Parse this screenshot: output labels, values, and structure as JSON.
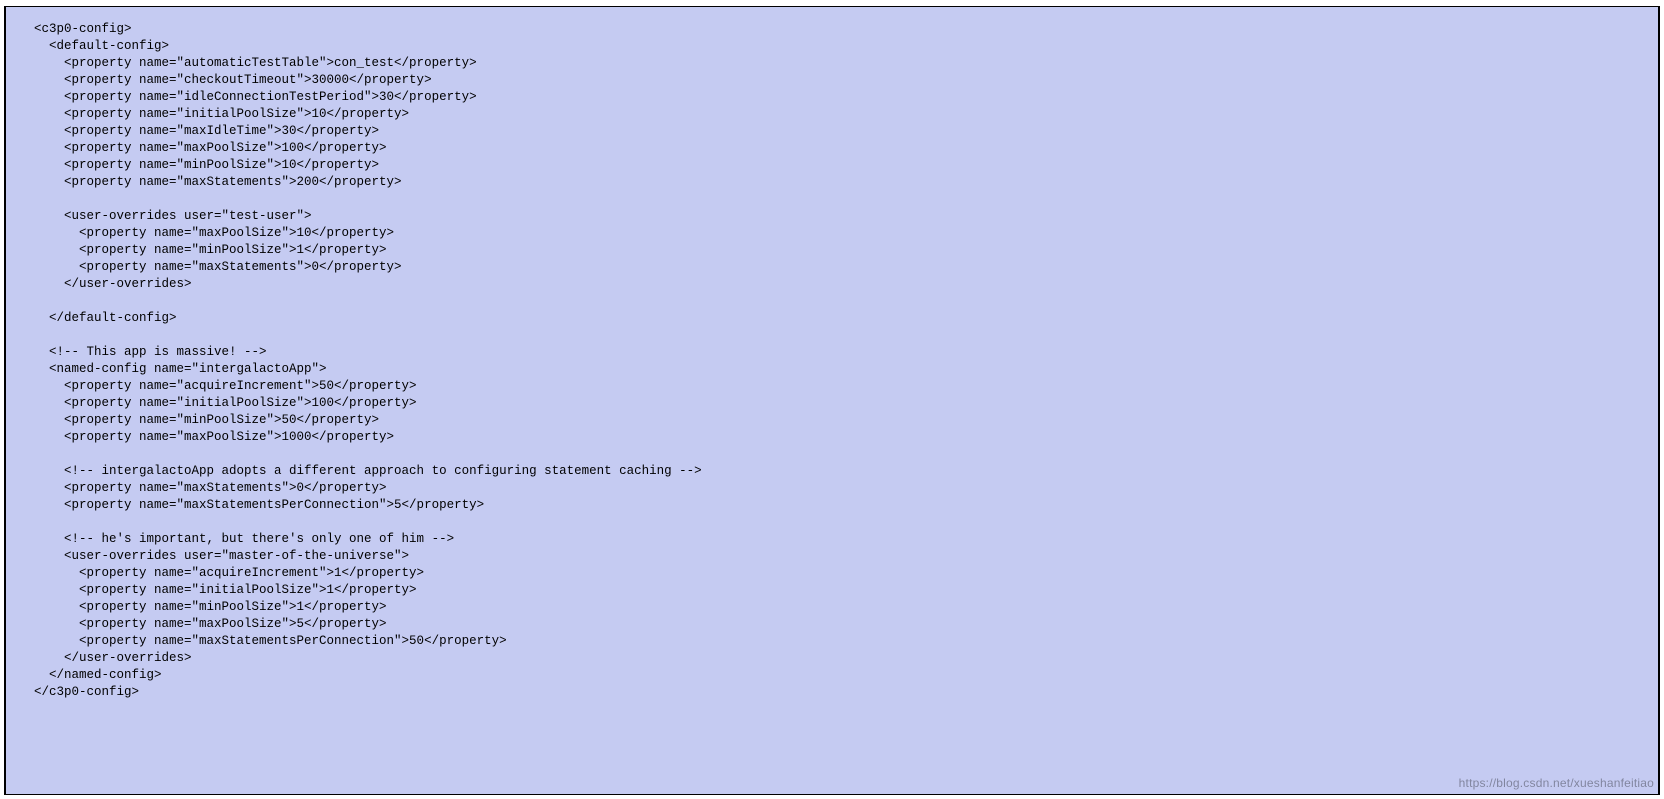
{
  "watermark": "https://blog.csdn.net/xueshanfeitiao",
  "code_lines": [
    "<c3p0-config>",
    "  <default-config>",
    "    <property name=\"automaticTestTable\">con_test</property>",
    "    <property name=\"checkoutTimeout\">30000</property>",
    "    <property name=\"idleConnectionTestPeriod\">30</property>",
    "    <property name=\"initialPoolSize\">10</property>",
    "    <property name=\"maxIdleTime\">30</property>",
    "    <property name=\"maxPoolSize\">100</property>",
    "    <property name=\"minPoolSize\">10</property>",
    "    <property name=\"maxStatements\">200</property>",
    "",
    "    <user-overrides user=\"test-user\">",
    "      <property name=\"maxPoolSize\">10</property>",
    "      <property name=\"minPoolSize\">1</property>",
    "      <property name=\"maxStatements\">0</property>",
    "    </user-overrides>",
    "",
    "  </default-config>",
    "",
    "  <!-- This app is massive! -->",
    "  <named-config name=\"intergalactoApp\">",
    "    <property name=\"acquireIncrement\">50</property>",
    "    <property name=\"initialPoolSize\">100</property>",
    "    <property name=\"minPoolSize\">50</property>",
    "    <property name=\"maxPoolSize\">1000</property>",
    "",
    "    <!-- intergalactoApp adopts a different approach to configuring statement caching -->",
    "    <property name=\"maxStatements\">0</property>",
    "    <property name=\"maxStatementsPerConnection\">5</property>",
    "",
    "    <!-- he's important, but there's only one of him -->",
    "    <user-overrides user=\"master-of-the-universe\">",
    "      <property name=\"acquireIncrement\">1</property>",
    "      <property name=\"initialPoolSize\">1</property>",
    "      <property name=\"minPoolSize\">1</property>",
    "      <property name=\"maxPoolSize\">5</property>",
    "      <property name=\"maxStatementsPerConnection\">50</property>",
    "    </user-overrides>",
    "  </named-config>",
    "</c3p0-config>"
  ]
}
